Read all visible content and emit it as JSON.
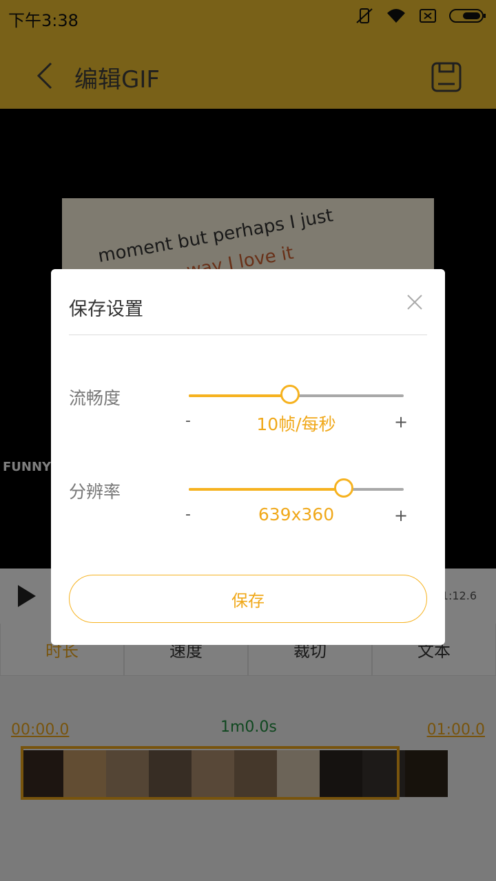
{
  "status": {
    "time": "下午3:38",
    "icons": [
      "vibrate-off-icon",
      "wifi-icon",
      "sim-off-icon",
      "battery-icon"
    ]
  },
  "appbar": {
    "title": "编辑GIF",
    "back_icon": "back-chevron-icon",
    "save_icon": "save-icon"
  },
  "preview": {
    "text_line1": "moment but perhaps I just",
    "text_line2": "way I love it",
    "watermark": "FUNNY"
  },
  "player": {
    "duration": "1:12.6",
    "play_icon": "play-icon"
  },
  "tabs": [
    {
      "label": "时长",
      "active": true
    },
    {
      "label": "速度",
      "active": false
    },
    {
      "label": "裁切",
      "active": false
    },
    {
      "label": "文本",
      "active": false
    }
  ],
  "timeline": {
    "start": "00:00.0",
    "length": "1m0.0s",
    "end": "01:00.0"
  },
  "dialog": {
    "title": "保存设置",
    "close_icon": "close-icon",
    "smoothness": {
      "label": "流畅度",
      "value_text": "10帧/每秒",
      "minus": "-",
      "plus": "+",
      "level": 0.47
    },
    "resolution": {
      "label": "分辨率",
      "value_text": "639x360",
      "minus": "-",
      "plus": "+",
      "level": 0.72
    },
    "save_label": "保存"
  },
  "colors": {
    "accent": "#f6b21f",
    "appbar": "#f2c230",
    "track": "#a8a8a8"
  }
}
